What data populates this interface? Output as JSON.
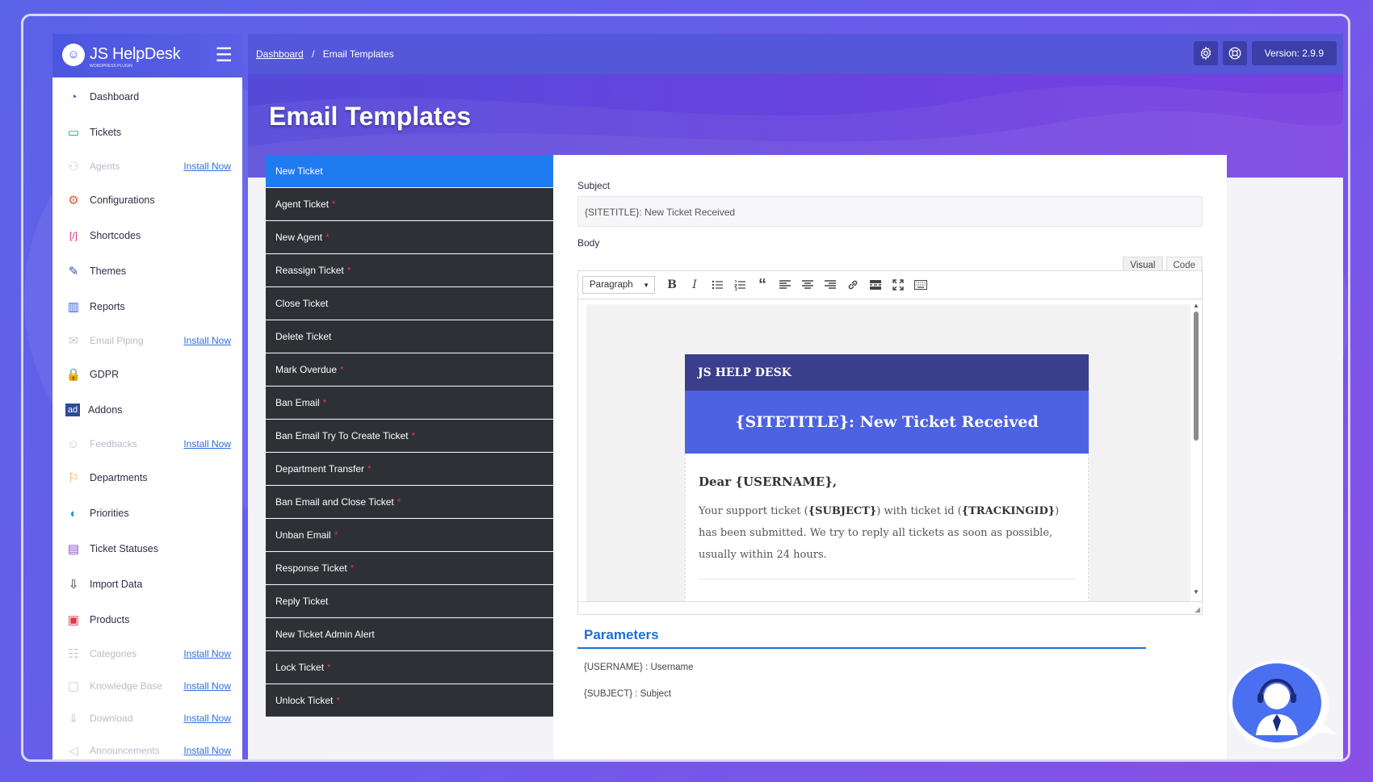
{
  "brand": {
    "logo_text": "JS HelpDesk",
    "logo_sub": "WORDPRESS PLUGIN"
  },
  "sidebar": {
    "items": [
      {
        "label": "Dashboard",
        "icon": "dashboard-icon",
        "disabled": false
      },
      {
        "label": "Tickets",
        "icon": "ticket-icon",
        "disabled": false
      },
      {
        "label": "Agents",
        "icon": "agents-icon",
        "disabled": true,
        "install": "Install Now"
      },
      {
        "label": "Configurations",
        "icon": "gear-icon",
        "disabled": false
      },
      {
        "label": "Shortcodes",
        "icon": "shortcode-icon",
        "disabled": false
      },
      {
        "label": "Themes",
        "icon": "brush-icon",
        "disabled": false
      },
      {
        "label": "Reports",
        "icon": "chart-icon",
        "disabled": false
      },
      {
        "label": "Email Piping",
        "icon": "mail-icon",
        "disabled": true,
        "install": "Install Now"
      },
      {
        "label": "GDPR",
        "icon": "lock-icon",
        "disabled": false
      },
      {
        "label": "Addons",
        "icon": "addons-icon",
        "disabled": false
      },
      {
        "label": "Feedbacks",
        "icon": "smile-icon",
        "disabled": true,
        "install": "Install Now"
      },
      {
        "label": "Departments",
        "icon": "department-icon",
        "disabled": false
      },
      {
        "label": "Priorities",
        "icon": "priority-icon",
        "disabled": false
      },
      {
        "label": "Ticket Statuses",
        "icon": "status-icon",
        "disabled": false
      },
      {
        "label": "Import Data",
        "icon": "import-icon",
        "disabled": false
      },
      {
        "label": "Products",
        "icon": "products-icon",
        "disabled": false
      },
      {
        "label": "Categories",
        "icon": "categories-icon",
        "disabled": true,
        "install": "Install Now"
      },
      {
        "label": "Knowledge Base",
        "icon": "book-icon",
        "disabled": true,
        "install": "Install Now"
      },
      {
        "label": "Download",
        "icon": "download-icon",
        "disabled": true,
        "install": "Install Now"
      },
      {
        "label": "Announcements",
        "icon": "megaphone-icon",
        "disabled": true,
        "install": "Install Now"
      }
    ]
  },
  "topbar": {
    "breadcrumb_home": "Dashboard",
    "breadcrumb_sep": "/",
    "breadcrumb_current": "Email Templates",
    "version": "Version: 2.9.9"
  },
  "page": {
    "title": "Email Templates"
  },
  "templates": [
    {
      "label": "New Ticket",
      "active": true,
      "star": false
    },
    {
      "label": "Agent Ticket",
      "active": false,
      "star": true
    },
    {
      "label": "New Agent",
      "active": false,
      "star": true
    },
    {
      "label": "Reassign Ticket",
      "active": false,
      "star": true
    },
    {
      "label": "Close Ticket",
      "active": false,
      "star": false
    },
    {
      "label": "Delete Ticket",
      "active": false,
      "star": false
    },
    {
      "label": "Mark Overdue",
      "active": false,
      "star": true
    },
    {
      "label": "Ban Email",
      "active": false,
      "star": true
    },
    {
      "label": "Ban Email Try To Create Ticket",
      "active": false,
      "star": true
    },
    {
      "label": "Department Transfer",
      "active": false,
      "star": true
    },
    {
      "label": "Ban Email and Close Ticket",
      "active": false,
      "star": true
    },
    {
      "label": "Unban Email",
      "active": false,
      "star": true
    },
    {
      "label": "Response Ticket",
      "active": false,
      "star": true
    },
    {
      "label": "Reply Ticket",
      "active": false,
      "star": false
    },
    {
      "label": "New Ticket Admin Alert",
      "active": false,
      "star": false
    },
    {
      "label": "Lock Ticket",
      "active": false,
      "star": true
    },
    {
      "label": "Unlock Ticket",
      "active": false,
      "star": true
    }
  ],
  "form": {
    "subject_label": "Subject",
    "subject_value": "{SITETITLE}: New Ticket Received",
    "body_label": "Body",
    "tab_visual": "Visual",
    "tab_code": "Code",
    "format_select": "Paragraph"
  },
  "email": {
    "header": "JS HELP DESK",
    "banner": "{SITETITLE}: New Ticket Received",
    "greeting": "Dear {USERNAME},",
    "p_before_subject": "Your support ticket (",
    "subject_token": "{SUBJECT}",
    "p_mid": ") with ticket id (",
    "tracking_token": "{TRACKINGID}",
    "p_after": ") has been submitted. We try to reply all tickets as soon as possible, usually within 24 hours."
  },
  "parameters": {
    "title": "Parameters",
    "items": [
      "{USERNAME} : Username",
      "{SUBJECT} : Subject"
    ]
  },
  "colors": {
    "accent": "#1e7bf0",
    "topbar": "#5457d8",
    "template_bg": "#2d3034",
    "required_star": "#e0354a"
  }
}
